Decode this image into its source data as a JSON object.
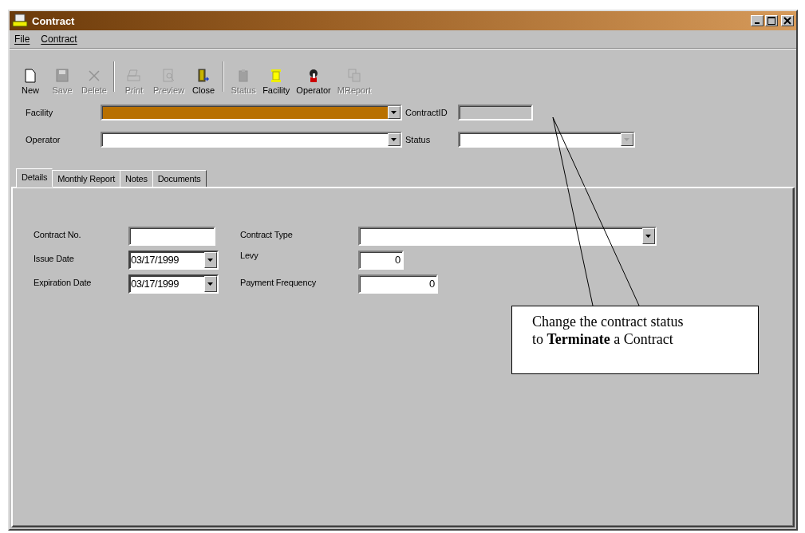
{
  "window": {
    "title": "Contract"
  },
  "menu": [
    "File",
    "Contract"
  ],
  "toolbar": [
    {
      "kind": "new",
      "label": "New",
      "disabled": false
    },
    {
      "kind": "save",
      "label": "Save",
      "disabled": true
    },
    {
      "kind": "delete",
      "label": "Delete",
      "disabled": true
    },
    {
      "kind": "separator"
    },
    {
      "kind": "print",
      "label": "Print",
      "disabled": true
    },
    {
      "kind": "preview",
      "label": "Preview",
      "disabled": true
    },
    {
      "kind": "close",
      "label": "Close",
      "disabled": false
    },
    {
      "kind": "separator"
    },
    {
      "kind": "status",
      "label": "Status",
      "disabled": true
    },
    {
      "kind": "facility",
      "label": "Facility",
      "disabled": false
    },
    {
      "kind": "operator",
      "label": "Operator",
      "disabled": false
    },
    {
      "kind": "report",
      "label": "MReport",
      "disabled": true
    }
  ],
  "header_fields": [
    {
      "label": "Facility",
      "kind": "combo",
      "focused": true,
      "disabled": false
    },
    {
      "label": "ContractID",
      "kind": "text",
      "focused": false,
      "disabled": true
    },
    {
      "label": "Operator",
      "kind": "combo",
      "focused": false,
      "disabled": false
    },
    {
      "label": "Status",
      "kind": "combo",
      "focused": false,
      "disabled": true
    }
  ],
  "tabs": [
    {
      "label": "Details",
      "selected": true
    },
    {
      "label": "Monthly Report",
      "selected": false
    },
    {
      "label": "Notes",
      "selected": false
    },
    {
      "label": "Documents",
      "selected": false
    }
  ],
  "detail_fields": [
    {
      "label": "Contract No.",
      "kind": "text"
    },
    {
      "label": "Contract Type",
      "kind": "combo"
    },
    {
      "label": "Issue Date",
      "kind": "date",
      "value": "03/17/1999"
    },
    {
      "label": "Levy",
      "kind": "number",
      "value": "0"
    },
    {
      "label": "Expiration Date",
      "kind": "date",
      "value": "03/17/1999"
    },
    {
      "label": "Payment Frequency",
      "kind": "number",
      "value": "0"
    }
  ],
  "callout": {
    "text": "Change the contract status to **Terminate** a Contract"
  }
}
